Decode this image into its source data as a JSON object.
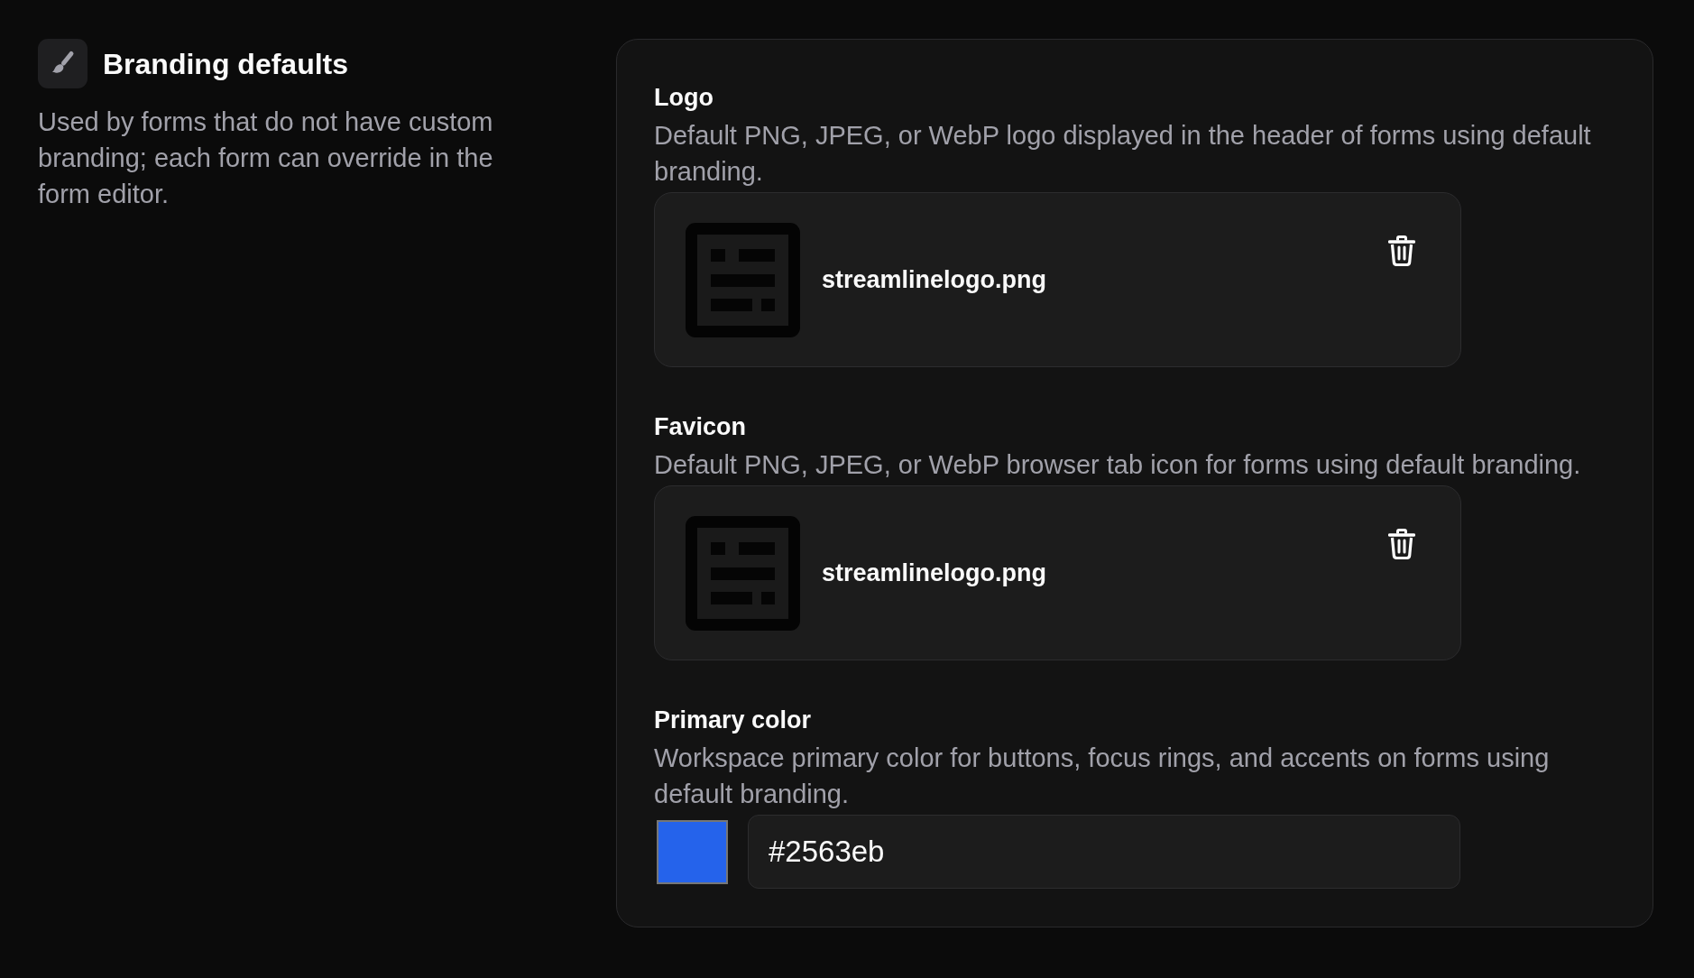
{
  "section": {
    "title": "Branding defaults",
    "description": "Used by forms that do not have custom branding; each form can override in the form editor."
  },
  "fields": [
    {
      "kind": "file",
      "label": "Logo",
      "description": "Default PNG, JPEG, or WebP logo displayed in the header of forms using default branding.",
      "file_name": "streamlinelogo.png"
    },
    {
      "kind": "file",
      "label": "Favicon",
      "description": "Default PNG, JPEG, or WebP browser tab icon for forms using default branding.",
      "file_name": "streamlinelogo.png"
    },
    {
      "kind": "color",
      "label": "Primary color",
      "description": "Workspace primary color for buttons, focus rings, and accents on forms using default branding.",
      "value": "#2563eb"
    }
  ]
}
